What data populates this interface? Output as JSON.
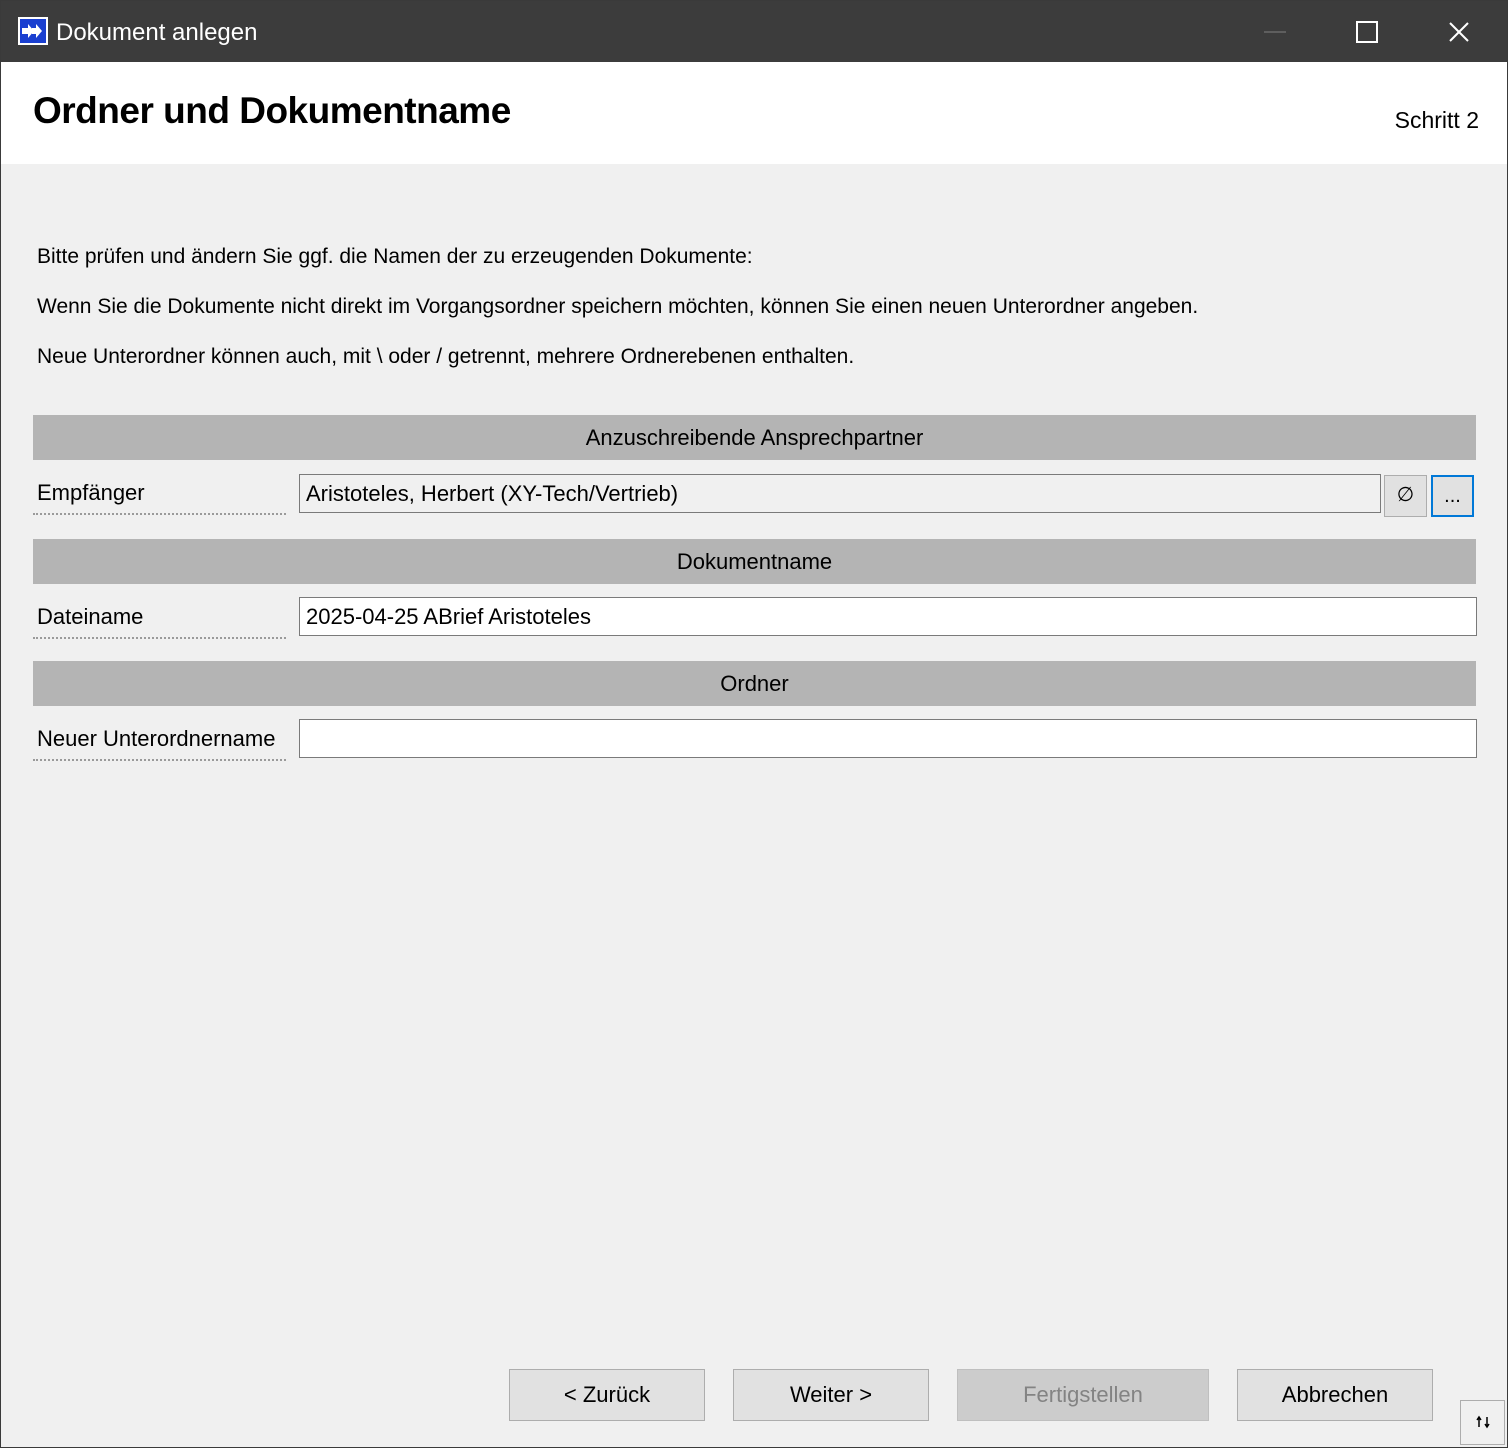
{
  "window": {
    "title": "Dokument anlegen",
    "controls": {
      "minimize": "minimize",
      "maximize": "maximize",
      "close": "close"
    }
  },
  "header": {
    "title": "Ordner und Dokumentname",
    "step": "Schritt 2"
  },
  "info": [
    "Bitte prüfen und ändern Sie ggf. die Namen der zu erzeugenden Dokumente:",
    "Wenn Sie die Dokumente nicht direkt im Vorgangsordner speichern möchten, können Sie einen neuen Unterordner angeben.",
    "Neue Unterordner können auch, mit \\ oder / getrennt, mehrere Ordnerebenen enthalten."
  ],
  "sections": {
    "recipients": {
      "header": "Anzuschreibende Ansprechpartner",
      "label": "Empfänger",
      "value": "Aristoteles, Herbert (XY-Tech/Vertrieb)",
      "clear_symbol": "∅",
      "browse_label": "..."
    },
    "document": {
      "header": "Dokumentname",
      "label": "Dateiname",
      "value": "2025-04-25 ABrief Aristoteles"
    },
    "folder": {
      "header": "Ordner",
      "label": "Neuer Unterordnername",
      "value": ""
    }
  },
  "buttons": {
    "back": "< Zurück",
    "next": "Weiter >",
    "finish": "Fertigstellen",
    "cancel": "Abbrechen"
  },
  "colors": {
    "titlebar": "#3c3c3c",
    "section_header": "#b4b4b4",
    "focus_border": "#0078d7"
  }
}
